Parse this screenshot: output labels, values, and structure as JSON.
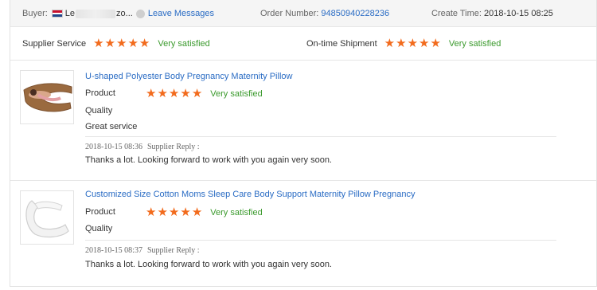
{
  "header": {
    "buyer_label": "Buyer:",
    "buyer_name_start": "Le",
    "buyer_name_end": "zo...",
    "leave_messages": "Leave Messages",
    "order_label": "Order Number:",
    "order_number": "94850940228236",
    "create_label": "Create Time:",
    "create_time": "2018-10-15 08:25"
  },
  "summary": {
    "supplier_service_label": "Supplier Service",
    "supplier_service_stars": 5,
    "supplier_service_text": "Very satisfied",
    "shipment_label": "On-time Shipment",
    "shipment_stars": 5,
    "shipment_text": "Very satisfied"
  },
  "reviews": [
    {
      "title": "U-shaped Polyester Body Pregnancy Maternity Pillow",
      "product_label": "Product",
      "product_stars": 5,
      "product_text": "Very satisfied",
      "quality_label": "Quality",
      "comment": "Great service",
      "reply_time": "2018-10-15 08:36",
      "reply_label": "Supplier Reply :",
      "reply_text": "Thanks a lot. Looking forward to work with you again very soon."
    },
    {
      "title": "Customized Size Cotton Moms Sleep Care Body Support Maternity Pillow Pregnancy",
      "product_label": "Product",
      "product_stars": 5,
      "product_text": "Very satisfied",
      "quality_label": "Quality",
      "reply_time": "2018-10-15 08:37",
      "reply_label": "Supplier Reply :",
      "reply_text": "Thanks a lot. Looking forward to work with you again very soon."
    }
  ],
  "colors": {
    "star": "#f26b1d",
    "satisfied": "#3b9a2d",
    "link": "#2a6cc4"
  }
}
